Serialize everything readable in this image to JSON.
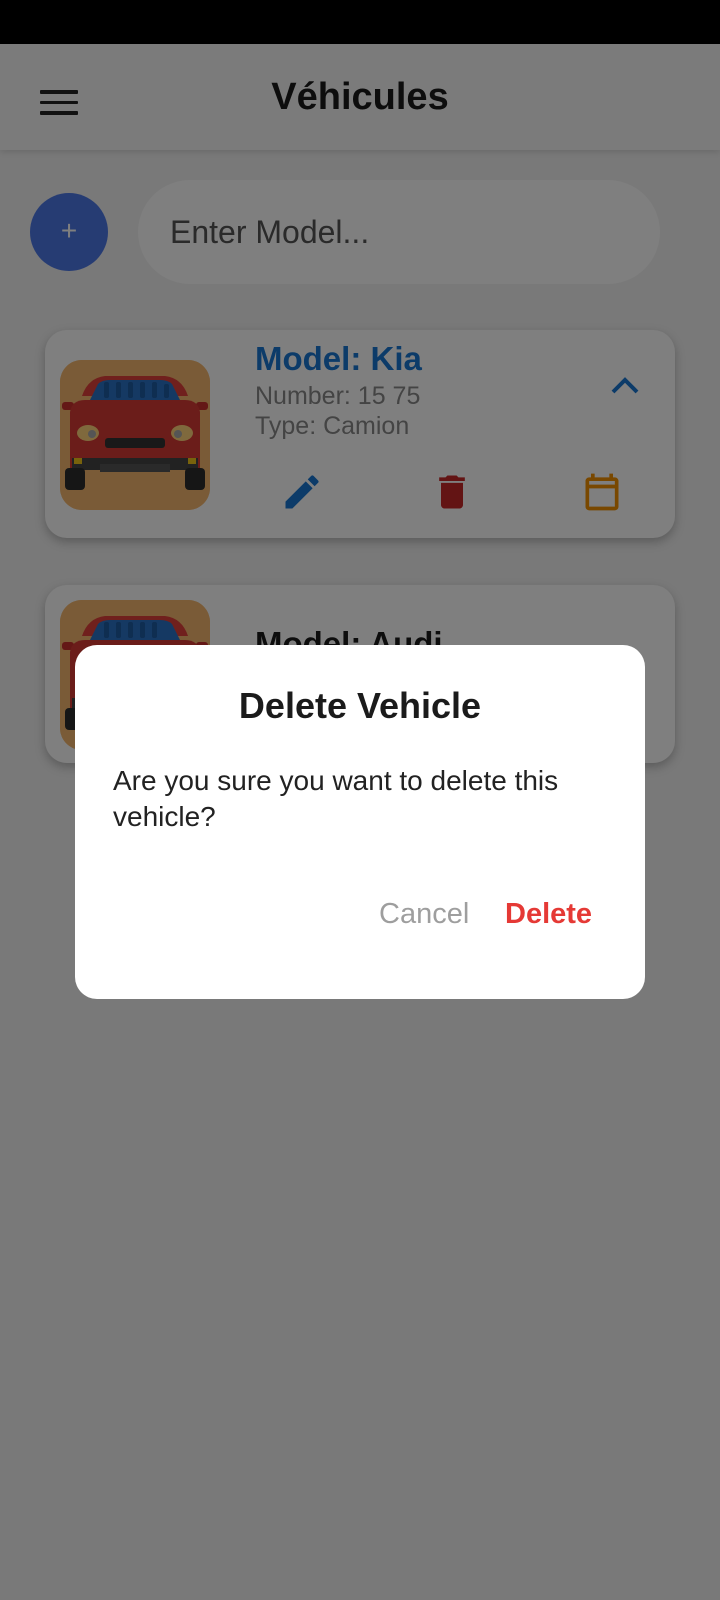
{
  "app_bar": {
    "title": "Véhicules"
  },
  "search": {
    "placeholder": "Enter Model..."
  },
  "add_button": {
    "label": "+"
  },
  "vehicles": [
    {
      "model": "Model: Kia",
      "number": "Number: 15 75",
      "type": "Type: Camion",
      "expanded": true
    },
    {
      "model": "Model: Audi",
      "expanded": false
    }
  ],
  "dialog": {
    "title": "Delete Vehicle",
    "message": "Are you sure you want to delete this vehicle?",
    "cancel_label": "Cancel",
    "delete_label": "Delete"
  },
  "icons": {
    "menu": "menu-icon",
    "expand": "chevron-up-icon",
    "edit": "edit-icon",
    "delete": "trash-icon",
    "calendar": "calendar-icon"
  },
  "colors": {
    "accent_blue": "#1976d2",
    "fab": "#4d78e6",
    "delete_red": "#e53935",
    "trash_red": "#c62828",
    "calendar_orange": "#f29100",
    "thumb_bg": "#f4b76e"
  }
}
